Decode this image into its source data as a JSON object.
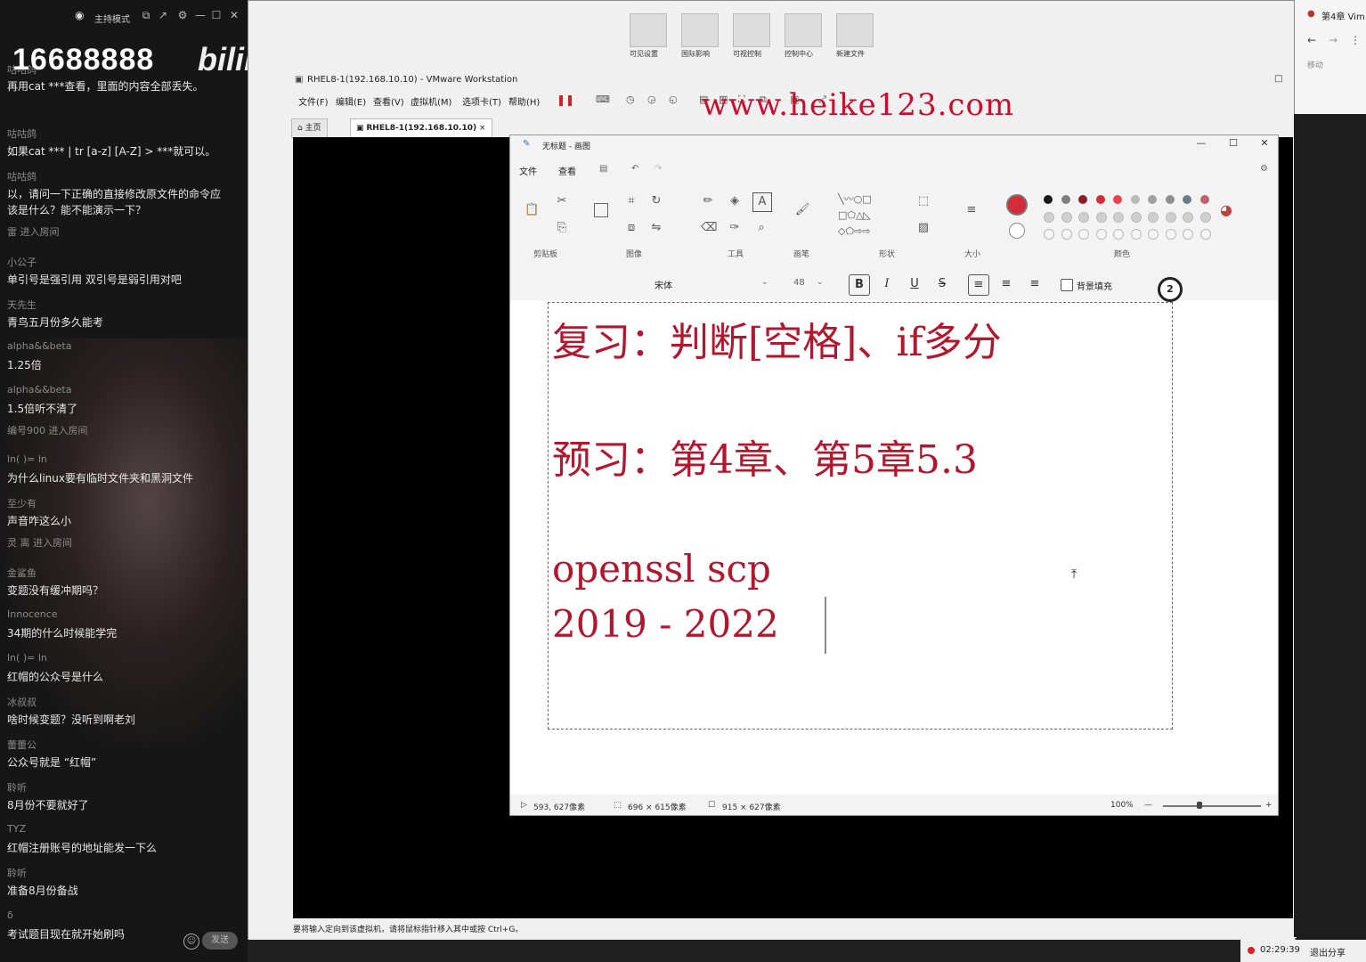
{
  "chat": {
    "header": {
      "mode_label": "主持模式"
    },
    "room_number": "16688888",
    "brand": "bilibili",
    "messages": [
      {
        "name": "咕咕鸽",
        "text": "再用cat ***查看，里面的内容全部丢失。"
      },
      {
        "name": "咕咕鸽",
        "text": "如果cat *** | tr [a-z] [A-Z] > ***就可以。"
      },
      {
        "name": "咕咕鸽",
        "text": "以，请问一下正确的直接修改原文件的命令应该是什么？能不能演示一下？"
      },
      {
        "name": "雷 进入房间",
        "text": ""
      },
      {
        "name": "小公子",
        "text": "单引号是强引用  双引号是弱引用对吧"
      },
      {
        "name": "天先生",
        "text": "青鸟五月份多久能考"
      },
      {
        "name": "alpha&&beta",
        "text": "1.25倍"
      },
      {
        "name": "alpha&&beta",
        "text": "1.5倍听不清了"
      },
      {
        "name": "编号900 进入房间",
        "text": ""
      },
      {
        "name": "ln(    )=      ln",
        "text": "为什么linux要有临时文件夹和黑洞文件"
      },
      {
        "name": "至少有",
        "text": "声音咋这么小"
      },
      {
        "name": "灵 离 进入房间",
        "text": ""
      },
      {
        "name": "金鲨鱼",
        "text": "变题没有缓冲期吗？"
      },
      {
        "name": "Innocence",
        "text": "34期的什么时候能学完"
      },
      {
        "name": "ln(    )=      ln",
        "text": "红帽的公众号是什么"
      },
      {
        "name": "冰叔叔",
        "text": "啥时候变题？没听到啊老刘"
      },
      {
        "name": "蕾蕾公",
        "text": "公众号就是 “红帽”"
      },
      {
        "name": "聆听",
        "text": "8月份不要就好了"
      },
      {
        "name": "TYZ",
        "text": "红帽注册账号的地址能发一下么"
      },
      {
        "name": "聆听",
        "text": "准备8月份备战"
      },
      {
        "name": "δ",
        "text": "考试题目现在就开始刷吗"
      }
    ],
    "send_label": "发送"
  },
  "vmware": {
    "title": "RHEL8-1(192.168.10.10) - VMware Workstation",
    "menu": [
      "文件(F)",
      "编辑(E)",
      "查看(V)",
      "虚拟机(M)",
      "选项卡(T)",
      "帮助(H)"
    ],
    "tabs": [
      {
        "label": "主页"
      },
      {
        "label": "RHEL8-1(192.168.10.10)"
      }
    ],
    "thumbnails": [
      "可见设置",
      "国际影响",
      "可视控制",
      "控制中心",
      "新建文件"
    ],
    "status_text": "要将输入定向到该虚拟机，请将鼠标指针移入其中或按 Ctrl+G。"
  },
  "watermark": "www.heike123.com",
  "paint": {
    "title": "无标题 - 画图",
    "menu": [
      "文件",
      "查看"
    ],
    "groups": [
      "剪贴板",
      "图像",
      "工具",
      "画笔",
      "形状",
      "大小",
      "颜色"
    ],
    "text_toolbar": {
      "font": "宋体",
      "size": "48",
      "bg_fill_label": "背景填充"
    },
    "badge": "2",
    "canvas_lines": [
      "复习：判断[空格]、if多分",
      "预习：第4章、第5章5.3",
      "openssl scp",
      "2019 - 2022"
    ],
    "status": {
      "cursor_pos": "593, 627像素",
      "selection": "696 × 615像素",
      "canvas_size": "915 × 627像素",
      "zoom": "100%"
    },
    "colors": {
      "text": "#b2172e",
      "primary": "#d62c3a"
    },
    "palette": [
      "#1a1a1a",
      "#7f7f7f",
      "#8a1c2a",
      "#d62c3a",
      "#e8434f",
      "#bbbbbb",
      "#a0a0a0",
      "#909090",
      "#6c7a8a",
      "#c06070"
    ]
  },
  "browser": {
    "tab_label": "第4章 Vim",
    "label": "移动"
  },
  "tray": {
    "time": "02:29:39",
    "share_label": "退出分享"
  }
}
